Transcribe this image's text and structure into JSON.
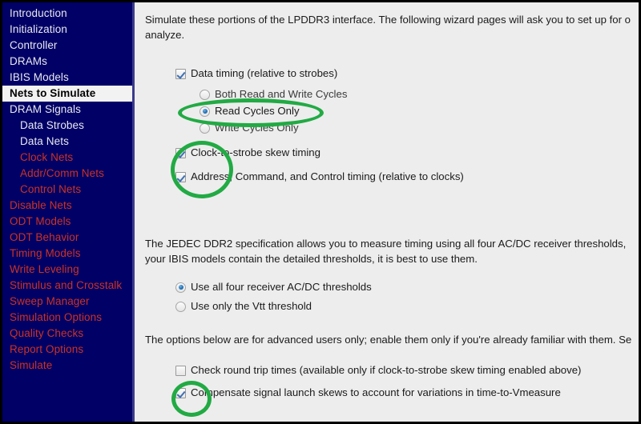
{
  "sidebar": {
    "items": [
      {
        "label": "Introduction",
        "style": "normal"
      },
      {
        "label": "Initialization",
        "style": "normal"
      },
      {
        "label": "Controller",
        "style": "normal"
      },
      {
        "label": "DRAMs",
        "style": "normal"
      },
      {
        "label": "IBIS Models",
        "style": "normal"
      },
      {
        "label": "Nets to Simulate",
        "style": "selected"
      },
      {
        "label": "DRAM Signals",
        "style": "normal"
      },
      {
        "label": "Data Strobes",
        "style": "indent"
      },
      {
        "label": "Data Nets",
        "style": "indent"
      },
      {
        "label": "Clock Nets",
        "style": "red-indent"
      },
      {
        "label": "Addr/Comm Nets",
        "style": "red-indent"
      },
      {
        "label": "Control Nets",
        "style": "red-indent"
      },
      {
        "label": "Disable Nets",
        "style": "red"
      },
      {
        "label": "ODT Models",
        "style": "red"
      },
      {
        "label": "ODT Behavior",
        "style": "red"
      },
      {
        "label": "Timing Models",
        "style": "red"
      },
      {
        "label": "Write Leveling",
        "style": "red"
      },
      {
        "label": "Stimulus and Crosstalk",
        "style": "red"
      },
      {
        "label": "Sweep Manager",
        "style": "red"
      },
      {
        "label": "Simulation Options",
        "style": "red"
      },
      {
        "label": "Quality Checks",
        "style": "red"
      },
      {
        "label": "Report Options",
        "style": "red"
      },
      {
        "label": "Simulate",
        "style": "red"
      }
    ]
  },
  "main": {
    "intro_paragraph_line1": "Simulate these portions of the LPDDR3 interface.  The following wizard pages will ask you to set up for o",
    "intro_paragraph_line2": "analyze.",
    "data_timing": {
      "label": "Data timing (relative to strobes)",
      "checked": true
    },
    "cycle_options": [
      {
        "label": "Both Read and Write Cycles",
        "selected": false
      },
      {
        "label": "Read Cycles Only",
        "selected": true
      },
      {
        "label": "Write Cycles Only",
        "selected": false
      }
    ],
    "clock_to_strobe": {
      "label": "Clock-to-strobe skew timing",
      "checked": true
    },
    "addr_command_control": {
      "label": "Address, Command, and Control timing (relative to clocks)",
      "checked": true
    },
    "jedec_paragraph_line1": "The JEDEC DDR2 specification allows you to measure timing using all four AC/DC receiver thresholds,",
    "jedec_paragraph_line2": "your IBIS models contain the detailed thresholds, it is best to use them.",
    "threshold_options": [
      {
        "label": "Use all four receiver AC/DC thresholds",
        "selected": true
      },
      {
        "label": "Use only the Vtt threshold",
        "selected": false
      }
    ],
    "advanced_paragraph": "The options below are for advanced users only; enable them only if you're already familiar with them. Se",
    "round_trip": {
      "label": "Check round trip times (available only if clock-to-strobe skew timing enabled above)",
      "checked": false
    },
    "compensate": {
      "label": "Compensate signal launch skews to account for variations in time-to-Vmeasure",
      "checked": true
    }
  },
  "annotations": {
    "accent_color": "#22aa44",
    "ellipse_read_cycles": "highlight-read-cycles-only",
    "ellipse_timing_checkboxes": "highlight-timing-checkboxes",
    "ellipse_compensate": "highlight-compensate-checkbox"
  },
  "colors": {
    "sidebar_background": "#000066",
    "sidebar_text": "#e8e8f0",
    "sidebar_text_disabled": "#cc3322",
    "panel_background": "#ededed",
    "selected_item_background": "#f2f2f2",
    "control_accent": "#1463a8"
  }
}
